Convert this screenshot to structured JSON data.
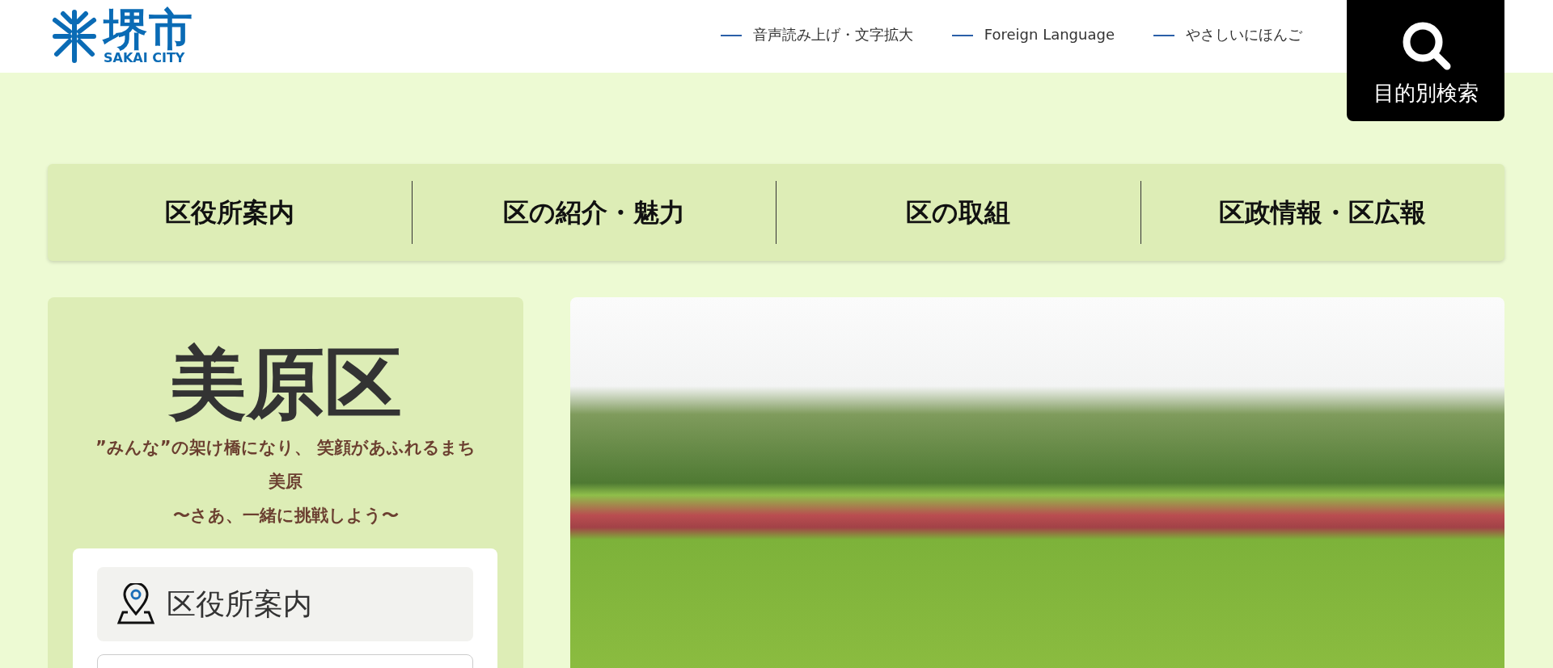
{
  "header": {
    "logo": {
      "kanji": "堺市",
      "roman": "SAKAI CITY"
    },
    "utility_links": [
      {
        "label": "音声読み上げ・文字拡大"
      },
      {
        "label": "Foreign Language"
      },
      {
        "label": "やさしいにほんご"
      }
    ],
    "search_button": {
      "label": "目的別検索"
    }
  },
  "main_nav": [
    {
      "label": "区役所案内"
    },
    {
      "label": "区の紹介・魅力"
    },
    {
      "label": "区の取組"
    },
    {
      "label": "区政情報・区広報"
    }
  ],
  "ward_panel": {
    "title": "美原区",
    "tagline": [
      "”みんな”の架け橋になり、 笑顔があふれるまち",
      "美原",
      "〜さあ、一緒に挑戦しよう〜"
    ],
    "menu": [
      {
        "label": "区役所案内"
      }
    ]
  }
}
